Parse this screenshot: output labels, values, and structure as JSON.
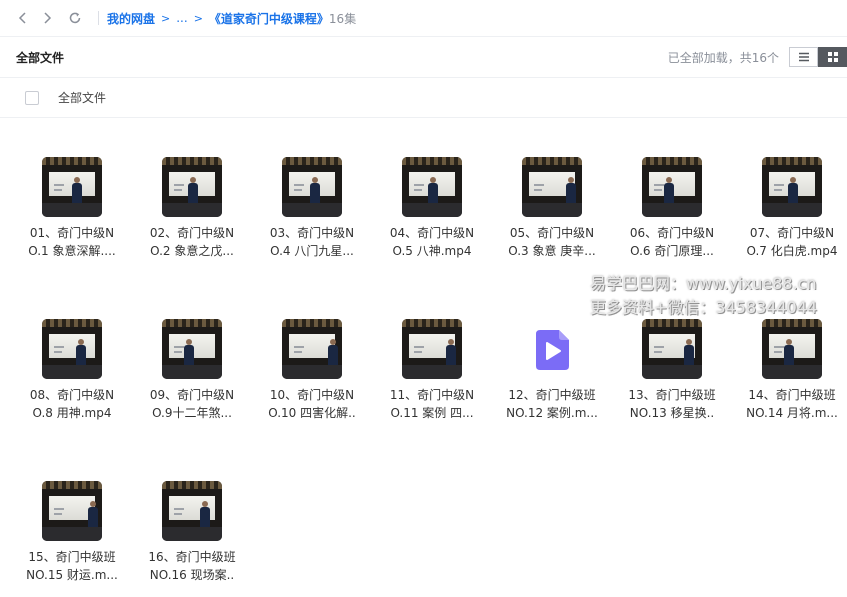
{
  "topbar": {
    "root": "我的网盘",
    "arrow": ">",
    "ellipsis": "...",
    "current": "《道家奇门中级课程》",
    "count": "16集"
  },
  "header": {
    "title": "全部文件",
    "status": "已全部加载，共16个"
  },
  "select_row": {
    "label": "全部文件"
  },
  "files": [
    {
      "line1": "01、奇门中级N",
      "line2": "O.1 象意深解....",
      "icon": "video-thumbnail"
    },
    {
      "line1": "02、奇门中级N",
      "line2": "O.2 象意之戊...",
      "icon": "video-thumbnail"
    },
    {
      "line1": "03、奇门中级N",
      "line2": "O.4 八门九星...",
      "icon": "video-thumbnail"
    },
    {
      "line1": "04、奇门中级N",
      "line2": "O.5 八神.mp4",
      "icon": "video-thumbnail"
    },
    {
      "line1": "05、奇门中级N",
      "line2": "O.3 象意 庚辛...",
      "icon": "video-thumbnail"
    },
    {
      "line1": "06、奇门中级N",
      "line2": "O.6 奇门原理...",
      "icon": "video-thumbnail"
    },
    {
      "line1": "07、奇门中级N",
      "line2": "O.7 化白虎.mp4",
      "icon": "video-thumbnail"
    },
    {
      "line1": "08、奇门中级N",
      "line2": "O.8 用神.mp4",
      "icon": "video-thumbnail"
    },
    {
      "line1": "09、奇门中级N",
      "line2": "O.9十二年煞...",
      "icon": "video-thumbnail"
    },
    {
      "line1": "10、奇门中级N",
      "line2": "O.10 四害化解..",
      "icon": "video-thumbnail"
    },
    {
      "line1": "11、奇门中级N",
      "line2": "O.11 案例 四...",
      "icon": "video-thumbnail"
    },
    {
      "line1": "12、奇门中级班",
      "line2": "NO.12 案例.m...",
      "icon": "video-file-icon"
    },
    {
      "line1": "13、奇门中级班",
      "line2": "NO.13 移星换..",
      "icon": "video-thumbnail"
    },
    {
      "line1": "14、奇门中级班",
      "line2": "NO.14 月将.m...",
      "icon": "video-thumbnail"
    },
    {
      "line1": "15、奇门中级班",
      "line2": "NO.15 财运.m...",
      "icon": "video-thumbnail"
    },
    {
      "line1": "16、奇门中级班",
      "line2": "NO.16 现场案..",
      "icon": "video-thumbnail"
    }
  ],
  "watermark": {
    "line1": "易学巴巴网：www.yixue88.cn",
    "line2": "更多资料+微信：3458344044"
  },
  "colors": {
    "accent": "#1a73e8",
    "video_icon": "#7b6cf6",
    "muted": "#8a8f99"
  }
}
